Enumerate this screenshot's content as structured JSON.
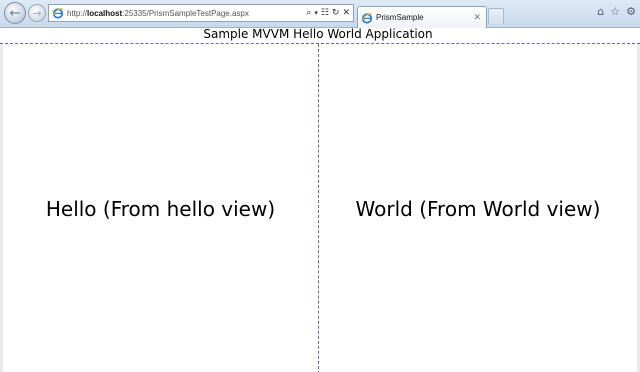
{
  "browser": {
    "url_prefix": "http://",
    "url_host": "localhost",
    "url_rest": ":25335/PrismSampleTestPage.aspx",
    "tab_title": "PrismSample",
    "icons": {
      "back": "back-arrow-icon",
      "forward": "forward-arrow-icon",
      "site": "ie-favicon",
      "search": "search-icon",
      "compat": "compatibility-icon",
      "refresh": "refresh-icon",
      "stop": "stop-icon",
      "home": "home-icon",
      "favorites": "star-icon",
      "tools": "gear-icon"
    }
  },
  "app": {
    "title": "Sample MVVM Hello World Application",
    "left_region_text": "Hello (From hello view)",
    "right_region_text": "World (From World view)"
  },
  "colors": {
    "divider": "#5a6fb3",
    "chrome": "#c9d9ec"
  }
}
